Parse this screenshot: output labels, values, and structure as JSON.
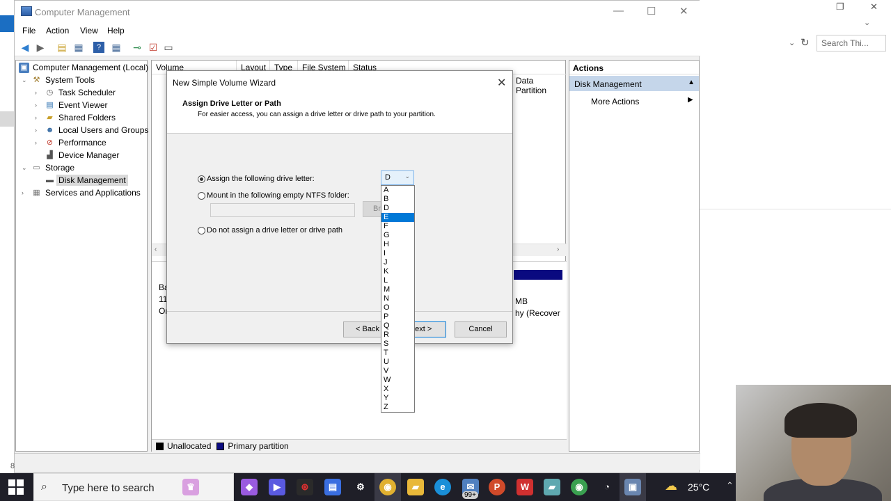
{
  "window": {
    "title": "Computer Management",
    "menu": [
      "File",
      "Action",
      "View",
      "Help"
    ]
  },
  "tree": {
    "root": "Computer Management (Local)",
    "items": [
      {
        "label": "System Tools",
        "indent": 1,
        "icon": "tools-icon"
      },
      {
        "label": "Task Scheduler",
        "indent": 2,
        "icon": "clock-icon"
      },
      {
        "label": "Event Viewer",
        "indent": 2,
        "icon": "event-viewer-icon"
      },
      {
        "label": "Shared Folders",
        "indent": 2,
        "icon": "shared-folder-icon"
      },
      {
        "label": "Local Users and Groups",
        "indent": 2,
        "icon": "users-icon"
      },
      {
        "label": "Performance",
        "indent": 2,
        "icon": "performance-icon"
      },
      {
        "label": "Device Manager",
        "indent": 2,
        "icon": "device-manager-icon"
      },
      {
        "label": "Storage",
        "indent": 1,
        "icon": "storage-icon"
      },
      {
        "label": "Disk Management",
        "indent": 2,
        "icon": "disk-icon",
        "selected": true
      },
      {
        "label": "Services and Applications",
        "indent": 1,
        "icon": "services-icon"
      }
    ]
  },
  "volumes": {
    "columns": [
      "Volume",
      "Layout",
      "Type",
      "File System",
      "Status"
    ],
    "status_fragment": "Data Partition",
    "disk_fragments_left": [
      "Ba",
      "11",
      "Or"
    ],
    "disk_fragments_right": [
      "MB",
      "hy (Recover"
    ]
  },
  "legend": {
    "unallocated": "Unallocated",
    "primary": "Primary partition"
  },
  "actions": {
    "header": "Actions",
    "section": "Disk Management",
    "more": "More Actions"
  },
  "status_bar": "8",
  "wizard": {
    "title": "New Simple Volume Wizard",
    "heading": "Assign Drive Letter or Path",
    "subheading": "For easier access, you can assign a drive letter or drive path to your partition.",
    "option_assign": "Assign the following drive letter:",
    "option_mount": "Mount in the following empty NTFS folder:",
    "option_none": "Do not assign a drive letter or drive path",
    "browse_label": "Br",
    "back_label": "< Back",
    "next_label": "lext >",
    "cancel_label": "Cancel",
    "selected_letter": "D",
    "drive_letters": [
      "A",
      "B",
      "D",
      "E",
      "F",
      "G",
      "H",
      "I",
      "J",
      "K",
      "L",
      "M",
      "N",
      "O",
      "P",
      "Q",
      "R",
      "S",
      "T",
      "U",
      "V",
      "W",
      "X",
      "Y",
      "Z"
    ],
    "highlighted_letter": "E"
  },
  "background_window": {
    "search_placeholder": "Search Thi..."
  },
  "taskbar": {
    "search_placeholder": "Type here to search",
    "badge": "99+",
    "temperature": "25°C"
  }
}
